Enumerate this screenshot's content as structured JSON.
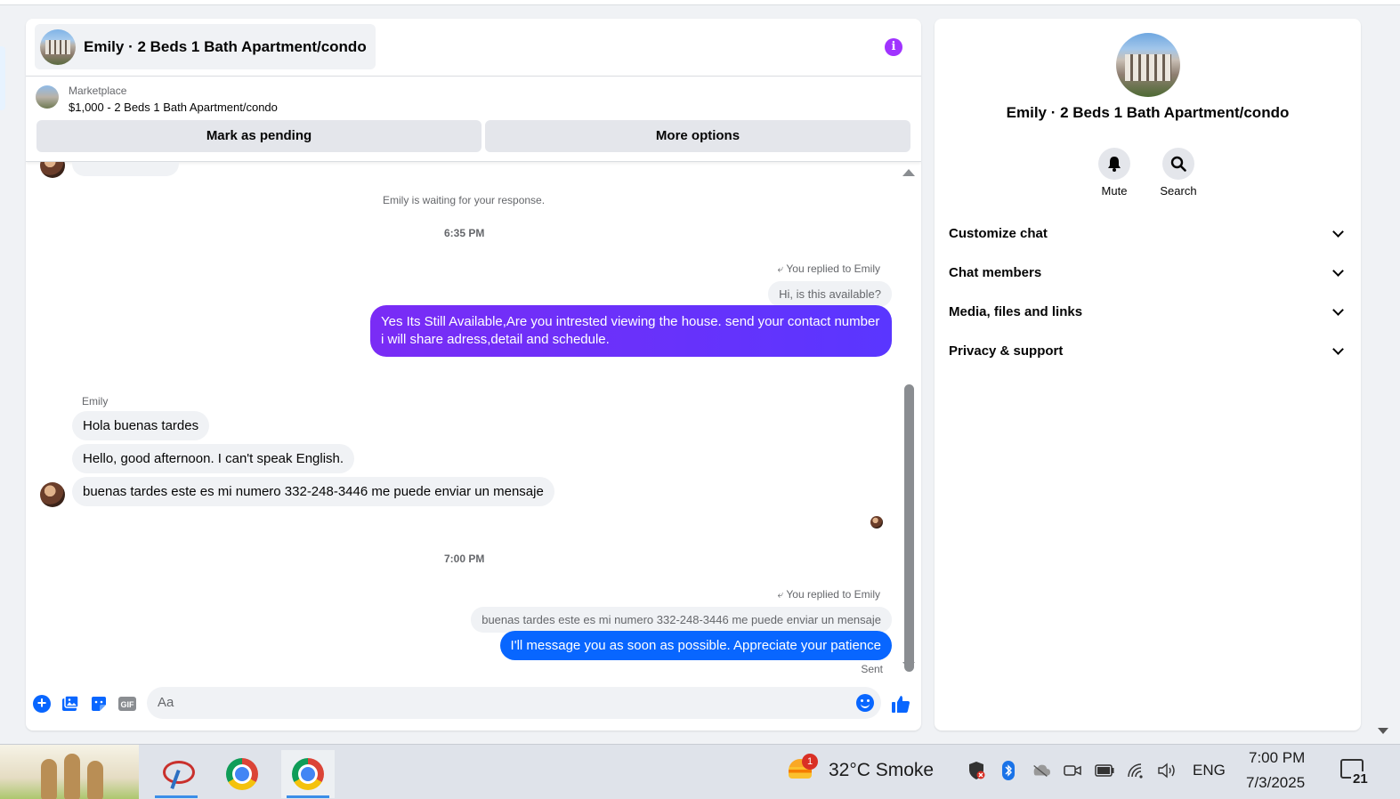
{
  "chat": {
    "title": "Emily · 2 Beds 1 Bath Apartment/condo",
    "marketplace_label": "Marketplace",
    "listing": "$1,000 - 2 Beds 1 Bath Apartment/condo",
    "mark_pending": "Mark as pending",
    "more_options": "More options",
    "info_icon": "i"
  },
  "messages": {
    "waiting_notice": "Emily is waiting for your response.",
    "time1": "6:35 PM",
    "reply1_note": "You replied to Emily",
    "reply1_quote": "Hi, is this available?",
    "reply1_text": "Yes Its Still Available,Are you intrested viewing the house. send your contact number i will share adress,detail and schedule.",
    "sender": "Emily",
    "in1": "Hola buenas tardes",
    "in2": "Hello, good afternoon. I can't speak English.",
    "in3": "buenas tardes este es mi numero 332-248-3446 me puede enviar un mensaje",
    "time2": "7:00 PM",
    "reply2_note": "You replied to Emily",
    "reply2_quote": "buenas tardes este es mi numero 332-248-3446 me puede enviar un mensaje",
    "reply2_text": "I'll message you as soon as possible. Appreciate your patience",
    "status": "Sent"
  },
  "composer": {
    "placeholder": "Aa",
    "gif_label": "GIF"
  },
  "side": {
    "name": "Emily · 2 Beds 1 Bath Apartment/condo",
    "mute": "Mute",
    "search": "Search",
    "sections": [
      "Customize chat",
      "Chat members",
      "Media, files and links",
      "Privacy & support"
    ]
  },
  "taskbar": {
    "weather_badge": "1",
    "weather": "32°C  Smoke",
    "lang": "ENG",
    "time": "7:00 PM",
    "date": "7/3/2025",
    "notifications": "21"
  },
  "colors": {
    "accent_blue": "#0866ff",
    "accent_purple": "#6c2bff",
    "info_purple": "#a033ff"
  }
}
